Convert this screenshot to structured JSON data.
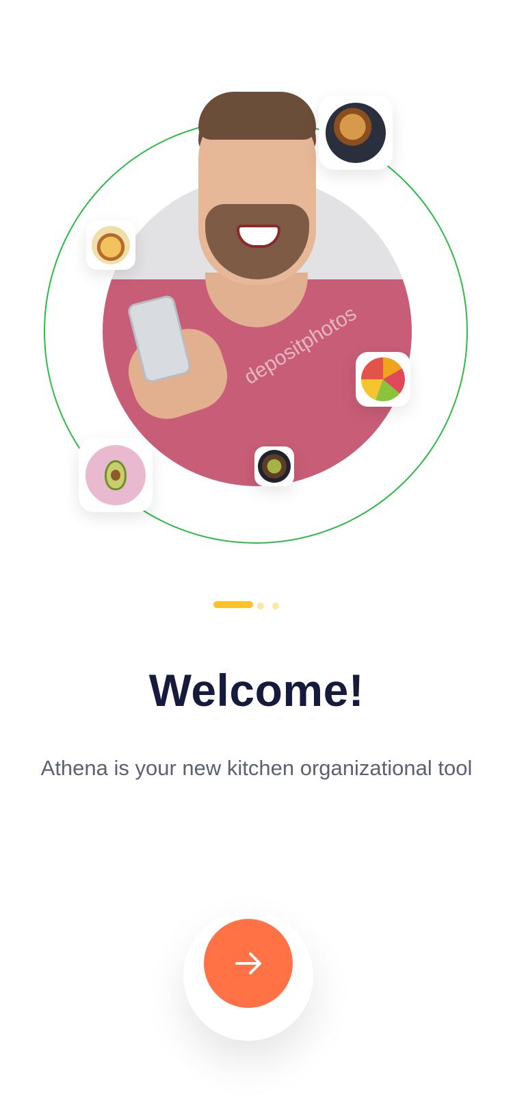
{
  "onboarding": {
    "title": "Welcome!",
    "subtitle": "Athena is your new kitchen organizational tool",
    "page_indicator": {
      "total": 3,
      "active": 1
    }
  },
  "hero": {
    "watermark": "depositphotos",
    "food_icons": [
      "pancake-stack-icon",
      "frying-pan-dish-icon",
      "citrus-slices-icon",
      "avocado-icon",
      "veggie-bowl-icon"
    ]
  },
  "next_button": {
    "icon": "arrow-right-icon"
  },
  "colors": {
    "accent": "#ff7245",
    "orbit": "#2dbb45",
    "indicator_active": "#fbc22a",
    "indicator_inactive": "#fde7a3",
    "title": "#161b3d",
    "body": "#5b6170"
  }
}
